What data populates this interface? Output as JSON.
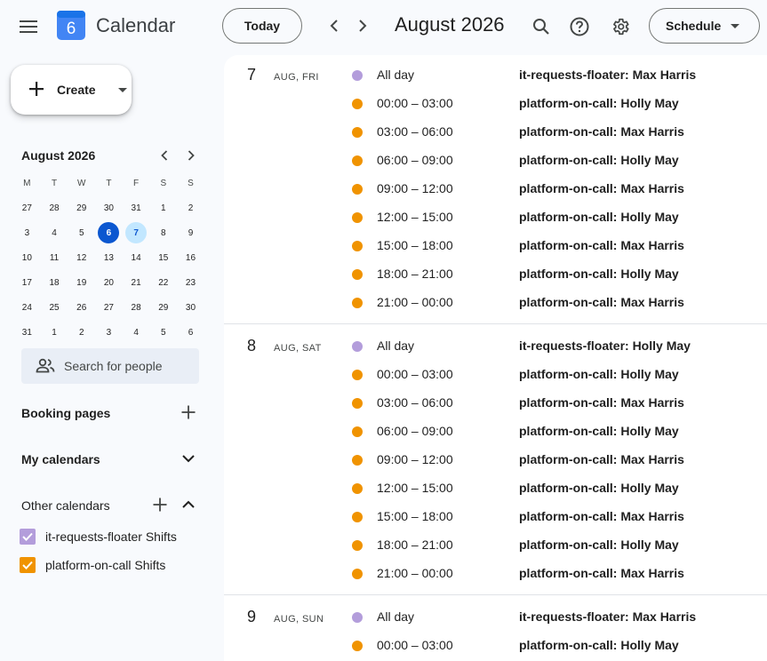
{
  "header": {
    "app_title": "Calendar",
    "logo_day": "6",
    "today_label": "Today",
    "month_title": "August 2026",
    "view_label": "Schedule"
  },
  "sidebar": {
    "create_label": "Create",
    "mini_calendar": {
      "title": "August 2026",
      "weekdays": [
        "M",
        "T",
        "W",
        "T",
        "F",
        "S",
        "S"
      ],
      "weeks": [
        [
          "27",
          "28",
          "29",
          "30",
          "31",
          "1",
          "2"
        ],
        [
          "3",
          "4",
          "5",
          "6",
          "7",
          "8",
          "9"
        ],
        [
          "10",
          "11",
          "12",
          "13",
          "14",
          "15",
          "16"
        ],
        [
          "17",
          "18",
          "19",
          "20",
          "21",
          "22",
          "23"
        ],
        [
          "24",
          "25",
          "26",
          "27",
          "28",
          "29",
          "30"
        ],
        [
          "31",
          "1",
          "2",
          "3",
          "4",
          "5",
          "6"
        ]
      ],
      "today": "6",
      "selected": "7"
    },
    "search_people_placeholder": "Search for people",
    "booking_pages_label": "Booking pages",
    "my_calendars_label": "My calendars",
    "other_calendars_label": "Other calendars",
    "other_calendars": [
      {
        "label": "it-requests-floater Shifts",
        "color": "#b39ddb",
        "checked": true
      },
      {
        "label": "platform-on-call Shifts",
        "color": "#f09300",
        "checked": true
      }
    ]
  },
  "colors": {
    "floater": "#b39ddb",
    "oncall": "#f09300",
    "accent": "#0b57d0"
  },
  "schedule": [
    {
      "day_num": "7",
      "day_label": "AUG, FRI",
      "events": [
        {
          "time": "All day",
          "title": "it-requests-floater: Max Harris",
          "calendar": "floater"
        },
        {
          "time": "00:00 – 03:00",
          "title": "platform-on-call: Holly May",
          "calendar": "oncall"
        },
        {
          "time": "03:00 – 06:00",
          "title": "platform-on-call: Max Harris",
          "calendar": "oncall"
        },
        {
          "time": "06:00 – 09:00",
          "title": "platform-on-call: Holly May",
          "calendar": "oncall"
        },
        {
          "time": "09:00 – 12:00",
          "title": "platform-on-call: Max Harris",
          "calendar": "oncall"
        },
        {
          "time": "12:00 – 15:00",
          "title": "platform-on-call: Holly May",
          "calendar": "oncall"
        },
        {
          "time": "15:00 – 18:00",
          "title": "platform-on-call: Max Harris",
          "calendar": "oncall"
        },
        {
          "time": "18:00 – 21:00",
          "title": "platform-on-call: Holly May",
          "calendar": "oncall"
        },
        {
          "time": "21:00 – 00:00",
          "title": "platform-on-call: Max Harris",
          "calendar": "oncall"
        }
      ]
    },
    {
      "day_num": "8",
      "day_label": "AUG, SAT",
      "events": [
        {
          "time": "All day",
          "title": "it-requests-floater: Holly May",
          "calendar": "floater"
        },
        {
          "time": "00:00 – 03:00",
          "title": "platform-on-call: Holly May",
          "calendar": "oncall"
        },
        {
          "time": "03:00 – 06:00",
          "title": "platform-on-call: Max Harris",
          "calendar": "oncall"
        },
        {
          "time": "06:00 – 09:00",
          "title": "platform-on-call: Holly May",
          "calendar": "oncall"
        },
        {
          "time": "09:00 – 12:00",
          "title": "platform-on-call: Max Harris",
          "calendar": "oncall"
        },
        {
          "time": "12:00 – 15:00",
          "title": "platform-on-call: Holly May",
          "calendar": "oncall"
        },
        {
          "time": "15:00 – 18:00",
          "title": "platform-on-call: Max Harris",
          "calendar": "oncall"
        },
        {
          "time": "18:00 – 21:00",
          "title": "platform-on-call: Holly May",
          "calendar": "oncall"
        },
        {
          "time": "21:00 – 00:00",
          "title": "platform-on-call: Max Harris",
          "calendar": "oncall"
        }
      ]
    },
    {
      "day_num": "9",
      "day_label": "AUG, SUN",
      "events": [
        {
          "time": "All day",
          "title": "it-requests-floater: Max Harris",
          "calendar": "floater"
        },
        {
          "time": "00:00 – 03:00",
          "title": "platform-on-call: Holly May",
          "calendar": "oncall"
        }
      ]
    }
  ]
}
